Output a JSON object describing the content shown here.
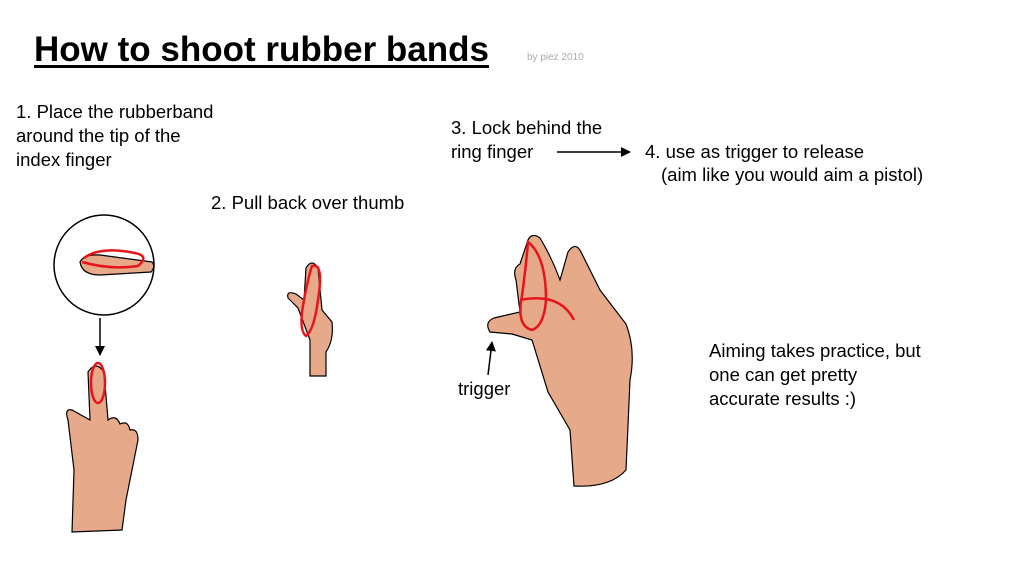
{
  "title": "How to shoot rubber bands",
  "credit": "by piez 2010",
  "steps": {
    "step1": [
      "1. Place  the rubberband",
      "around the tip of the",
      "index finger"
    ],
    "step2": "2. Pull back over thumb",
    "step3": [
      "3. Lock behind the",
      "ring finger"
    ],
    "step4": [
      "4. use as trigger to release",
      "(aim like you would aim a pistol)"
    ]
  },
  "labels": {
    "trigger": "trigger"
  },
  "note": [
    "Aiming takes practice, but",
    "one can get pretty",
    "accurate results :)"
  ],
  "colors": {
    "skin": "#e6a98a",
    "skin_outline": "#000000",
    "band": "#e8141b",
    "background": "#ffffff"
  }
}
